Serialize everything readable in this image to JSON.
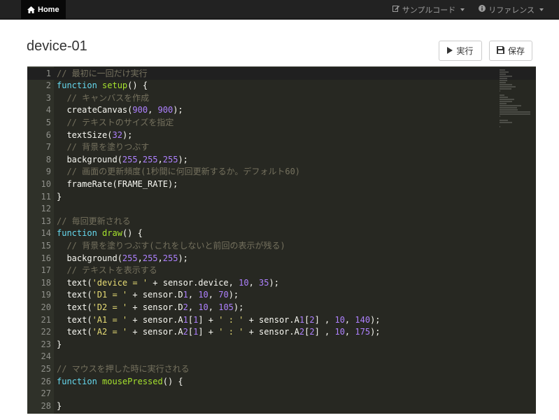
{
  "navbar": {
    "home_label": "Home",
    "menu_sample": "サンプルコード",
    "menu_reference": "リファレンス"
  },
  "page": {
    "title": "device-01"
  },
  "toolbar": {
    "run_label": "実行",
    "save_label": "保存"
  },
  "editor": {
    "lines": [
      "// 最初に一回だけ実行",
      "function setup() {",
      "  // キャンバスを作成",
      "  createCanvas(900, 900);",
      "  // テキストのサイズを指定",
      "  textSize(32);",
      "  // 背景を塗りつぶす",
      "  background(255,255,255);",
      "  // 画面の更新頻度(1秒間に何回更新するか。デフォルト60)",
      "  frameRate(FRAME_RATE);",
      "}",
      "",
      "// 毎回更新される",
      "function draw() {",
      "  // 背景を塗りつぶす(これをしないと前回の表示が残る)",
      "  background(255,255,255);",
      "  // テキストを表示する",
      "  text('device = ' + sensor.device, 10, 35);",
      "  text('D1 = ' + sensor.D1, 10, 70);",
      "  text('D2 = ' + sensor.D2, 10, 105);",
      "  text('A1 = ' + sensor.A1[1] + ' : ' + sensor.A1[2] , 10, 140);",
      "  text('A2 = ' + sensor.A2[1] + ' : ' + sensor.A2[2] , 10, 175);",
      "}",
      "",
      "// マウスを押した時に実行される",
      "function mousePressed() {",
      "",
      "}"
    ],
    "active_line": 1
  },
  "colors": {
    "navbar_bg": "#222222",
    "editor_bg": "#272822",
    "comment": "#75715e",
    "keyword": "#66d9ef",
    "function_name": "#a6e22e",
    "number": "#ae81ff",
    "string": "#e6db74"
  },
  "icons": {
    "home": "home-icon",
    "sample": "edit-icon",
    "reference": "info-icon",
    "run": "play-icon",
    "save": "save-icon"
  }
}
